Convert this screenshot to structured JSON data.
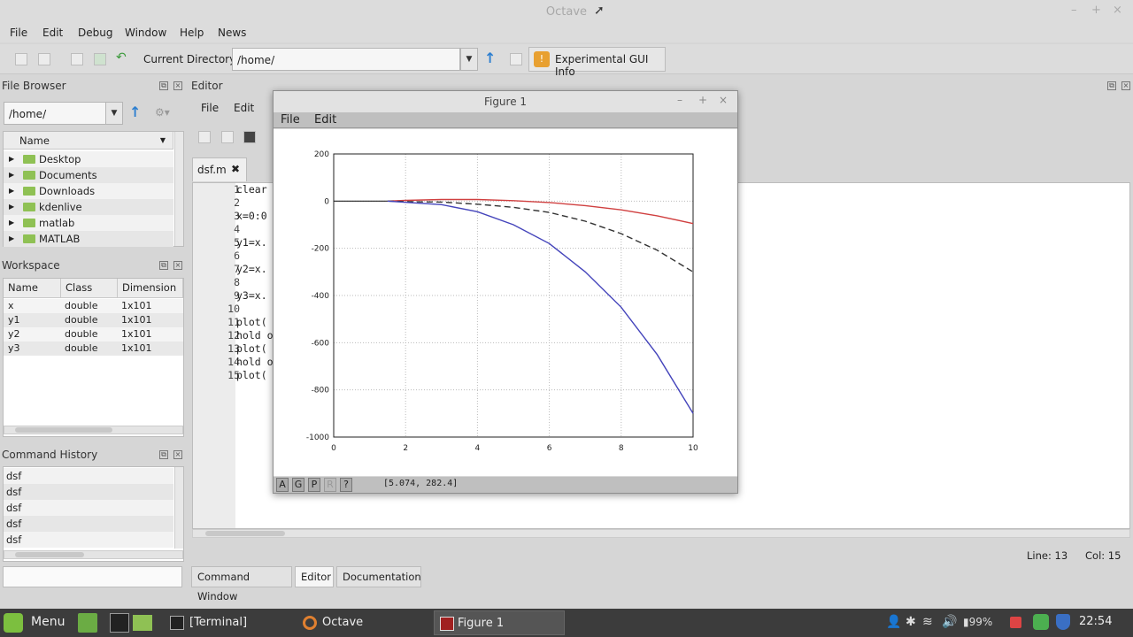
{
  "window": {
    "title": "Octave"
  },
  "menu": [
    "File",
    "Edit",
    "Debug",
    "Window",
    "Help",
    "News"
  ],
  "toolbar": {
    "current_dir_label": "Current Directory:",
    "current_dir_value": "/home/",
    "gui_info_label": "Experimental GUI Info"
  },
  "file_browser": {
    "title": "File Browser",
    "path": "/home/",
    "column": "Name",
    "items": [
      "Desktop",
      "Documents",
      "Downloads",
      "kdenlive",
      "matlab",
      "MATLAB"
    ]
  },
  "workspace": {
    "title": "Workspace",
    "columns": [
      "Name",
      "Class",
      "Dimension"
    ],
    "rows": [
      {
        "name": "x",
        "class": "double",
        "dim": "1x101"
      },
      {
        "name": "y1",
        "class": "double",
        "dim": "1x101"
      },
      {
        "name": "y2",
        "class": "double",
        "dim": "1x101"
      },
      {
        "name": "y3",
        "class": "double",
        "dim": "1x101"
      }
    ]
  },
  "history": {
    "title": "Command History",
    "items": [
      "dsf",
      "dsf",
      "dsf",
      "dsf",
      "dsf"
    ]
  },
  "editor": {
    "title": "Editor",
    "menu": [
      "File",
      "Edit"
    ],
    "tab": "dsf.m",
    "lines": [
      {
        "n": "1",
        "t": "clear"
      },
      {
        "n": "2",
        "t": ""
      },
      {
        "n": "3",
        "t": "x=0:0"
      },
      {
        "n": "4",
        "t": ""
      },
      {
        "n": "5",
        "t": "y1=x."
      },
      {
        "n": "6",
        "t": ""
      },
      {
        "n": "7",
        "t": "y2=x."
      },
      {
        "n": "8",
        "t": ""
      },
      {
        "n": "9",
        "t": "y3=x."
      },
      {
        "n": "10",
        "t": ""
      },
      {
        "n": "11",
        "t": "plot("
      },
      {
        "n": "12",
        "t": "hold o"
      },
      {
        "n": "13",
        "t": "plot("
      },
      {
        "n": "14",
        "t": "hold o"
      },
      {
        "n": "15",
        "t": "plot("
      }
    ],
    "status_line": "Line:  13",
    "status_col": "Col:  15"
  },
  "bottom_tabs": [
    "Command Window",
    "Editor",
    "Documentation"
  ],
  "figure": {
    "title": "Figure 1",
    "menu": [
      "File",
      "Edit"
    ],
    "toolbar_buttons": [
      "A",
      "G",
      "P",
      "R",
      "?"
    ],
    "coords": "[5.074, 282.4]"
  },
  "chart_data": {
    "type": "line",
    "xlim": [
      0,
      10
    ],
    "ylim": [
      -1000,
      200
    ],
    "xticks": [
      "0",
      "2",
      "4",
      "6",
      "8",
      "10"
    ],
    "yticks": [
      "200",
      "0",
      "-200",
      "-400",
      "-600",
      "-800",
      "-1000"
    ],
    "grid": true,
    "series": [
      {
        "color": "#d04040",
        "style": "solid",
        "x": [
          1.5,
          2,
          3,
          4,
          5,
          6,
          7,
          8,
          9,
          10
        ],
        "y": [
          0,
          3,
          7,
          7,
          2,
          -6,
          -19,
          -37,
          -62,
          -95
        ]
      },
      {
        "color": "#333333",
        "style": "dashed",
        "x": [
          1.5,
          2,
          3,
          4,
          5,
          6,
          7,
          8,
          9,
          10
        ],
        "y": [
          0,
          -2,
          -4,
          -13,
          -26,
          -48,
          -85,
          -138,
          -208,
          -300
        ]
      },
      {
        "color": "#4444bb",
        "style": "solid",
        "x": [
          1.5,
          2,
          3,
          4,
          5,
          6,
          7,
          8,
          9,
          10
        ],
        "y": [
          0,
          -5,
          -15,
          -45,
          -100,
          -180,
          -300,
          -450,
          -650,
          -900
        ]
      }
    ]
  },
  "taskbar": {
    "menu": "Menu",
    "tasks": [
      "[Terminal]",
      "Octave",
      "Figure 1"
    ],
    "battery": "99%",
    "clock": "22:54"
  }
}
